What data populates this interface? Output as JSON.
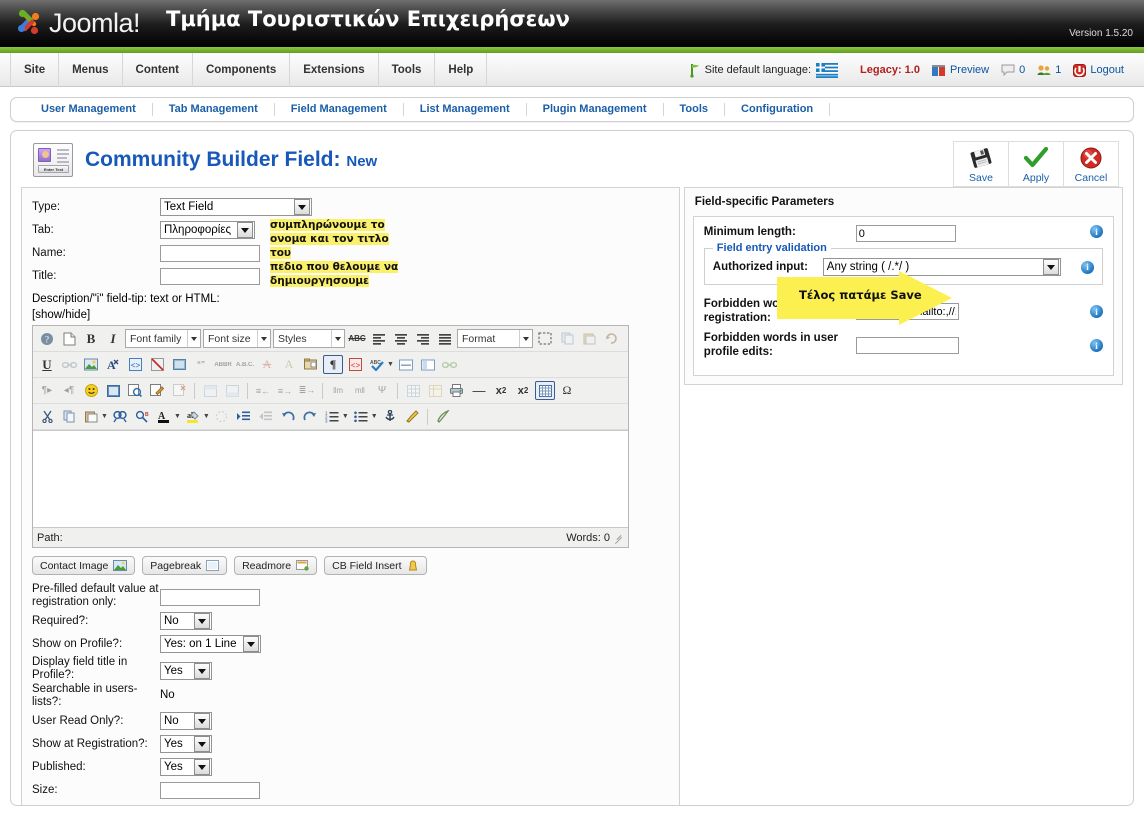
{
  "header": {
    "brand": "Joomla!",
    "site_name": "Τμήμα Τουριστικών Επιχειρήσεων",
    "version": "Version 1.5.20"
  },
  "menu": {
    "items": [
      {
        "label": "Site"
      },
      {
        "label": "Menus"
      },
      {
        "label": "Content"
      },
      {
        "label": "Components"
      },
      {
        "label": "Extensions"
      },
      {
        "label": "Tools"
      },
      {
        "label": "Help"
      }
    ]
  },
  "header_right": {
    "language_label": "Site default language:",
    "legacy": "Legacy: 1.0",
    "preview": "Preview",
    "messages_count": "0",
    "users_count": "1",
    "logout": "Logout"
  },
  "submenu": {
    "items": [
      {
        "label": "User Management"
      },
      {
        "label": "Tab Management"
      },
      {
        "label": "Field Management"
      },
      {
        "label": "List Management"
      },
      {
        "label": "Plugin Management"
      },
      {
        "label": "Tools"
      },
      {
        "label": "Configuration"
      }
    ]
  },
  "page": {
    "title": "Community Builder Field:",
    "title_suffix": "New"
  },
  "toolbar": {
    "save_label": "Save",
    "apply_label": "Apply",
    "cancel_label": "Cancel"
  },
  "callout": {
    "text": "Τέλος πατάμε Save"
  },
  "annotation": {
    "line1": "συμπληρώνουμε το",
    "line2": "ονομα και τον τιτλο του",
    "line3": "πεδιο που θελουμε να",
    "line4": "δημιουργησουμε"
  },
  "form": {
    "type_label": "Type:",
    "type_value": "Text Field",
    "tab_label": "Tab:",
    "tab_value": "Πληροφορίες",
    "name_label": "Name:",
    "name_value": "",
    "title_label": "Title:",
    "title_value": "",
    "description_label": "Description/\"i\" field-tip: text or HTML:",
    "showhide": "[show/hide]",
    "prefilled_label": "Pre-filled default value at registration only:",
    "prefilled_value": "",
    "required_label": "Required?:",
    "required_value": "No",
    "show_profile_label": "Show on Profile?:",
    "show_profile_value": "Yes: on 1 Line",
    "display_title_label": "Display field title in Profile?:",
    "display_title_value": "Yes",
    "searchable_label": "Searchable in users-lists?:",
    "searchable_value": "No",
    "readonly_label": "User Read Only?:",
    "readonly_value": "No",
    "show_registration_label": "Show at Registration?:",
    "show_registration_value": "Yes",
    "published_label": "Published:",
    "published_value": "Yes",
    "size_label": "Size:",
    "size_value": ""
  },
  "editor": {
    "font_family": "Font family",
    "font_size": "Font size",
    "styles": "Styles",
    "format": "Format",
    "path_label": "Path:",
    "words_label": "Words: 0",
    "buttons": [
      {
        "label": "Contact Image"
      },
      {
        "label": "Pagebreak"
      },
      {
        "label": "Readmore"
      },
      {
        "label": "CB Field Insert"
      }
    ]
  },
  "rightpanel": {
    "heading": "Field-specific Parameters",
    "min_length_label": "Minimum length:",
    "min_length_value": "0",
    "validation_legend": "Field entry validation",
    "authorized_label": "Authorized input:",
    "authorized_value": "Any string ( /.*/ )",
    "forbidden_reg_label": "Forbidden words at registration:",
    "forbidden_reg_value": "http:,https:,mailto:,//.",
    "forbidden_edit_label": "Forbidden words in user profile edits:",
    "forbidden_edit_value": ""
  },
  "colors": {
    "brand_green": "#8dc63f",
    "link_blue": "#1b5ea8",
    "title_blue": "#1758ba",
    "callout_yellow": "#fbf06a",
    "legacy_red": "#b32020"
  }
}
